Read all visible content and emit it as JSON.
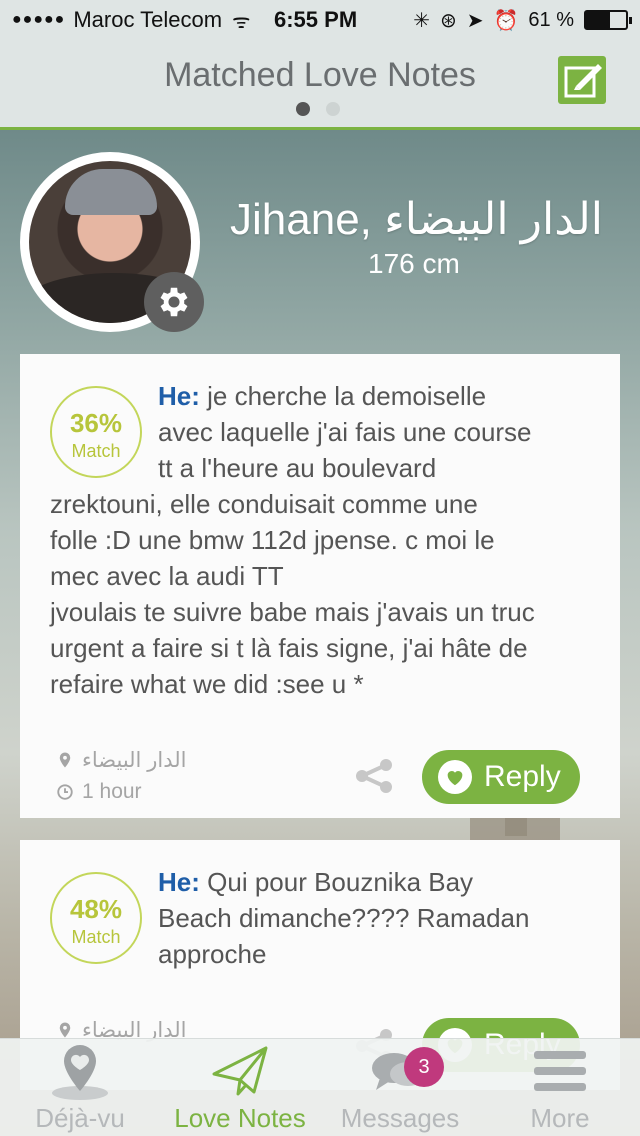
{
  "status_bar": {
    "signal": "●●●●●",
    "carrier": "Maroc Telecom",
    "time": "6:55 PM",
    "battery_percent": "61 %",
    "battery_level": 0.61
  },
  "nav": {
    "title": "Matched Love Notes",
    "page_count": 2,
    "active_page": 0
  },
  "profile": {
    "name": "Jihane, الدار البيضاء",
    "height": "176 cm"
  },
  "notes": [
    {
      "match_percent": "36%",
      "match_label": "Match",
      "prefix": "He:",
      "lines_indented": [
        " je cherche la demoiselle",
        "avec laquelle j'ai fais une course",
        "tt a l'heure au boulevard"
      ],
      "lines_full": [
        "zrektouni, elle conduisait comme une",
        "folle :D une bmw 112d jpense.  c moi le",
        "mec avec la audi TT",
        "jvoulais te suivre babe mais j'avais un truc",
        "urgent a faire si t là fais signe,  j'ai hâte de",
        "refaire what we did :see u *"
      ],
      "location": "الدار البيضاء",
      "time_ago": "1 hour",
      "reply_label": "Reply"
    },
    {
      "match_percent": "48%",
      "match_label": "Match",
      "prefix": "He:",
      "lines_indented": [
        " Qui pour Bouznika Bay",
        "Beach dimanche????  Ramadan",
        "approche"
      ],
      "location": "الدار البيضاء",
      "reply_label": "Reply"
    }
  ],
  "tabs": [
    {
      "label": "Déjà-vu",
      "icon": "map-pin-icon"
    },
    {
      "label": "Love Notes",
      "icon": "paper-plane-icon",
      "active": true
    },
    {
      "label": "Messages",
      "icon": "chat-bubbles-icon",
      "badge": "3"
    },
    {
      "label": "More",
      "icon": "menu-icon"
    }
  ],
  "colors": {
    "accent": "#7cb342",
    "he_label": "#1f5ea8",
    "match_ring": "#c3d65a",
    "badge": "#c0397d"
  }
}
